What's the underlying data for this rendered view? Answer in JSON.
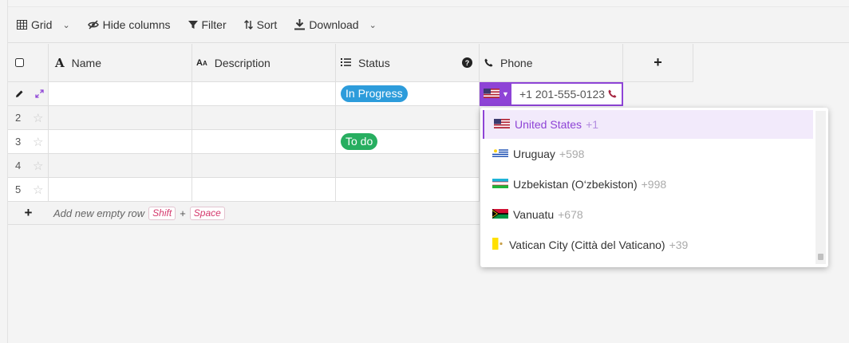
{
  "toolbar": {
    "grid_label": "Grid",
    "hide_columns_label": "Hide columns",
    "filter_label": "Filter",
    "sort_label": "Sort",
    "download_label": "Download"
  },
  "columns": {
    "name": "Name",
    "description": "Description",
    "status": "Status",
    "phone": "Phone"
  },
  "rows": [
    {
      "index": "",
      "status": "In Progress",
      "status_color": "#2d9cdb"
    },
    {
      "index": "2",
      "status": "",
      "status_color": ""
    },
    {
      "index": "3",
      "status": "To do",
      "status_color": "#27ae60"
    },
    {
      "index": "4",
      "status": "",
      "status_color": ""
    },
    {
      "index": "5",
      "status": "",
      "status_color": ""
    }
  ],
  "phone_editor": {
    "value": "+1 201-555-0123",
    "country_flag": "us-flag-icon"
  },
  "add_row": {
    "label": "Add new empty row",
    "key1": "Shift",
    "plus": "+",
    "key2": "Space"
  },
  "country_options": [
    {
      "name": "United States",
      "code": "+1",
      "selected": true,
      "flag": "us-flag-icon"
    },
    {
      "name": "Uruguay",
      "code": "+598",
      "selected": false,
      "flag": "uruguay-flag-icon"
    },
    {
      "name": "Uzbekistan (O‘zbekiston)",
      "code": "+998",
      "selected": false,
      "flag": "uzbekistan-flag-icon"
    },
    {
      "name": "Vanuatu",
      "code": "+678",
      "selected": false,
      "flag": "vanuatu-flag-icon"
    },
    {
      "name": "Vatican City (Città del Vaticano)",
      "code": "+39",
      "selected": false,
      "flag": "vatican-flag-icon"
    }
  ],
  "colors": {
    "accent": "#8e44d6",
    "in_progress": "#2d9cdb",
    "todo": "#27ae60"
  }
}
